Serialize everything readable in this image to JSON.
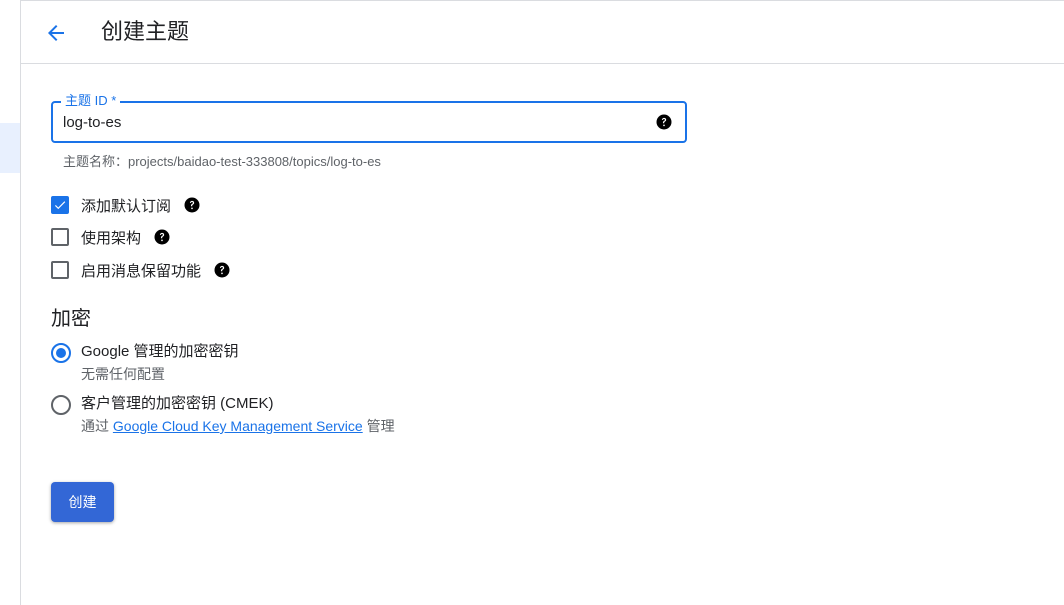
{
  "header": {
    "title": "创建主题",
    "back_icon": "arrow-back-icon"
  },
  "topic_field": {
    "label": "主题 ID *",
    "value": "log-to-es",
    "help_icon": "help-icon",
    "hint": "主题名称：projects/baidao-test-333808/topics/log-to-es"
  },
  "options": {
    "add_default_subscription": {
      "label": "添加默认订阅",
      "checked": true
    },
    "use_schema": {
      "label": "使用架构",
      "checked": false
    },
    "enable_retention": {
      "label": "启用消息保留功能",
      "checked": false
    }
  },
  "encryption": {
    "title": "加密",
    "google_managed": {
      "label": "Google 管理的加密密钥",
      "sub": "无需任何配置",
      "selected": true
    },
    "cmek": {
      "label": "客户管理的加密密钥 (CMEK)",
      "sub_prefix": "通过",
      "sub_link": "Google Cloud Key Management Service",
      "sub_suffix": "管理",
      "selected": false
    }
  },
  "actions": {
    "create_label": "创建"
  },
  "colors": {
    "accent": "#1a73e8",
    "button": "#3367d6"
  }
}
